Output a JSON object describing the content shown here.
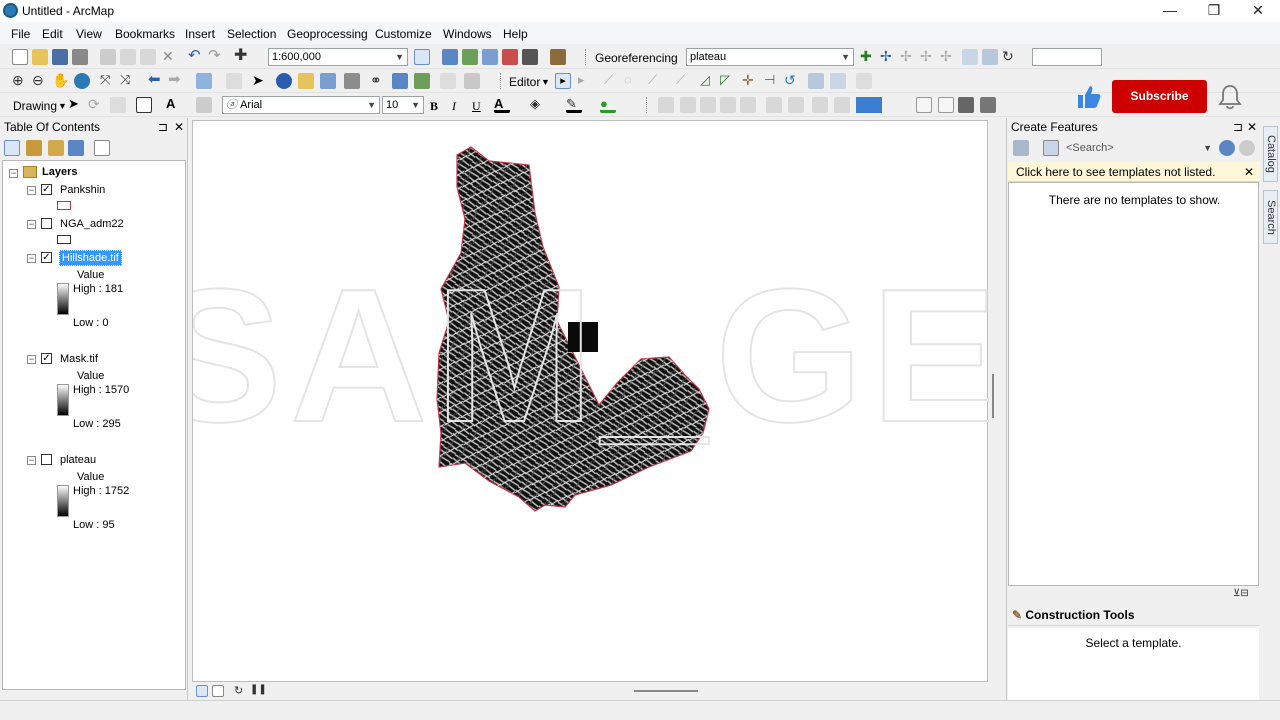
{
  "window": {
    "title": "Untitled - ArcMap"
  },
  "menu": [
    "File",
    "Edit",
    "View",
    "Bookmarks",
    "Insert",
    "Selection",
    "Geoprocessing",
    "Customize",
    "Windows",
    "Help"
  ],
  "toolbar": {
    "scale": "1:600,000",
    "georef_label": "Georeferencing",
    "georef_layer": "plateau",
    "editor_label": "Editor",
    "drawing_label": "Drawing",
    "font_name": "Arial",
    "font_size": "10",
    "bold": "B",
    "italic": "I",
    "underline": "U"
  },
  "toc": {
    "title": "Table Of Contents",
    "pin": "⊐",
    "close": "✕",
    "root": "Layers",
    "layers": [
      {
        "name": "Pankshin",
        "checked": "✓",
        "expand": "−"
      },
      {
        "name": "NGA_adm22",
        "checked": "",
        "expand": "−"
      },
      {
        "name": "Hillshade.tif",
        "checked": "✓",
        "expand": "−",
        "value_label": "Value",
        "high": "High : 181",
        "low": "Low : 0"
      },
      {
        "name": "Mask.tif",
        "checked": "✓",
        "expand": "−",
        "value_label": "Value",
        "high": "High : 1570",
        "low": "Low : 295"
      },
      {
        "name": "plateau",
        "checked": "",
        "expand": "−",
        "value_label": "Value",
        "high": "High : 1752",
        "low": "Low : 95"
      }
    ]
  },
  "create_features": {
    "title": "Create Features",
    "search_placeholder": "<Search>",
    "tip": "Click here to see templates not listed.",
    "empty": "There are no templates to show.",
    "construction_title": "Construction Tools",
    "construction_msg": "Select a template."
  },
  "side_tabs": [
    "Catalog",
    "Search"
  ],
  "overlay": {
    "subscribe": "Subscribe",
    "watermark": "PSAM_GEO"
  },
  "colors": {
    "selection": "#3399ff",
    "boundary": "#c0304a",
    "subscribe": "#cc0000"
  }
}
